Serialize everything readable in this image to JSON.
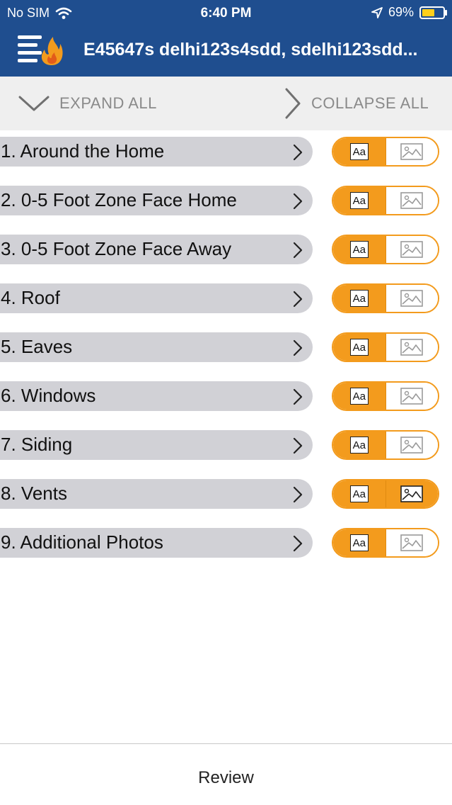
{
  "status_bar": {
    "carrier": "No SIM",
    "time": "6:40 PM",
    "battery_text": "69%",
    "battery_level": 0.69,
    "battery_color": "#ffcf1a"
  },
  "nav": {
    "title": "E45647s delhi123s4sdd, sdelhi123sdd...",
    "logo_icon": "hamburger-flame-logo",
    "bar_color": "#1f4e8f"
  },
  "toolbar": {
    "expand_label": "EXPAND ALL",
    "collapse_label": "COLLAPSE ALL"
  },
  "sections": [
    {
      "label": "1. Around the Home",
      "toggle_text": "Aa",
      "photo_active": false
    },
    {
      "label": "2. 0-5 Foot Zone Face Home",
      "toggle_text": "Aa",
      "photo_active": false
    },
    {
      "label": "3. 0-5 Foot Zone Face Away",
      "toggle_text": "Aa",
      "photo_active": false
    },
    {
      "label": "4. Roof",
      "toggle_text": "Aa",
      "photo_active": false
    },
    {
      "label": "5. Eaves",
      "toggle_text": "Aa",
      "photo_active": false
    },
    {
      "label": "6. Windows",
      "toggle_text": "Aa",
      "photo_active": false
    },
    {
      "label": "7. Siding",
      "toggle_text": "Aa",
      "photo_active": false
    },
    {
      "label": "8. Vents",
      "toggle_text": "Aa",
      "photo_active": true
    },
    {
      "label": "9. Additional Photos",
      "toggle_text": "Aa",
      "photo_active": false
    }
  ],
  "accent_color": "#f39b1d",
  "footer": {
    "review_label": "Review"
  }
}
